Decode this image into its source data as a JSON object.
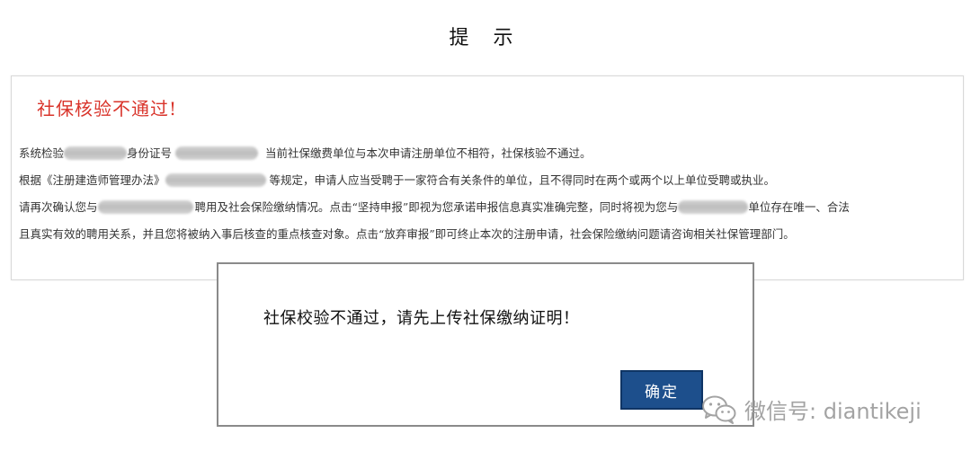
{
  "dialog": {
    "title": "提 示"
  },
  "panel": {
    "heading": "社保核验不通过!",
    "line1": {
      "prefix": "系统检验",
      "middle": "身份证号",
      "suffix": "当前社保缴费单位与本次申请注册单位不相符，社保核验不通过。"
    },
    "line2": {
      "prefix": "根据《注册建造师管理办法》",
      "suffix": "等规定，申请人应当受聘于一家符合有关条件的单位，且不得同时在两个或两个以上单位受聘或执业。"
    },
    "line3": {
      "prefix": "请再次确认您与",
      "middle": "聘用及社会保险缴纳情况。点击“坚持申报”即视为您承诺申报信息真实准确完整，同时将视为您与",
      "suffix": "单位存在唯一、合法"
    },
    "line4": {
      "text": "且真实有效的聘用关系，并且您将被纳入事后核查的重点核查对象。点击“放弃审报”即可终止本次的注册申请，社会保险缴纳问题请咨询相关社保管理部门。"
    }
  },
  "modal": {
    "message": "社保校验不通过，请先上传社保缴纳证明！",
    "confirm_label": "确定"
  },
  "watermark": {
    "text": "微信号: diantikeji",
    "icon": "wechat-icon"
  },
  "colors": {
    "heading_red": "#d9342b",
    "button_blue": "#1d4f8c"
  }
}
